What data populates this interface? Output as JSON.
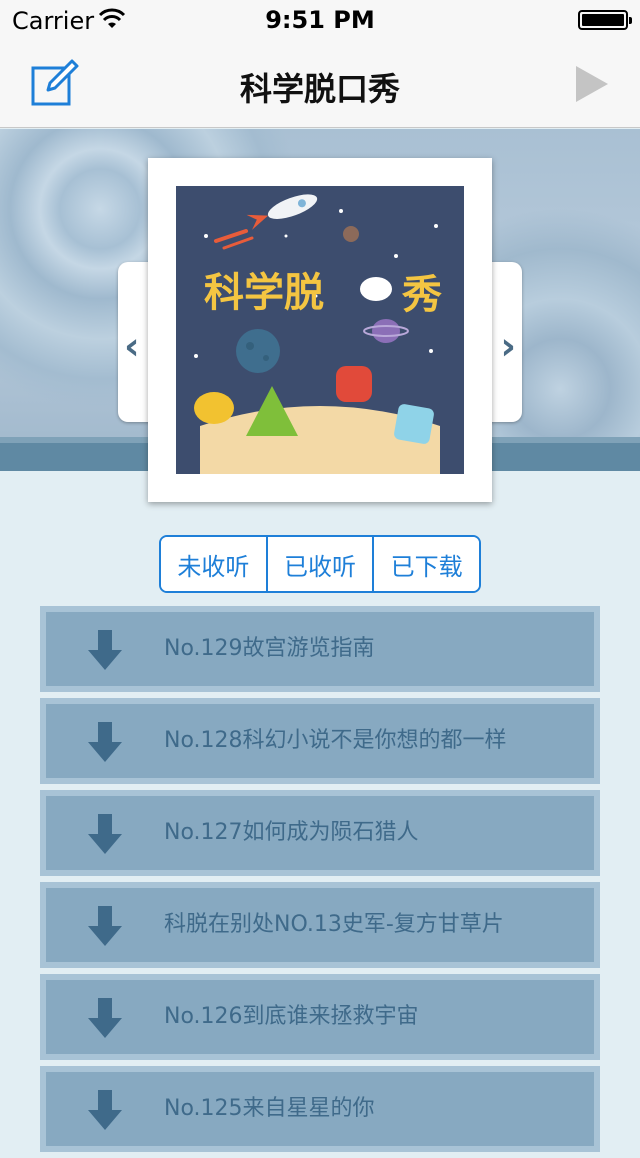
{
  "status": {
    "carrier": "Carrier",
    "time": "9:51 PM"
  },
  "nav": {
    "title": "科学脱口秀",
    "edit_icon": "edit-icon",
    "play_icon": "play-icon"
  },
  "cover": {
    "art_title": "科学脱口秀"
  },
  "segments": [
    "未收听",
    "已收听",
    "已下载"
  ],
  "episodes": [
    "No.129故宫游览指南",
    "No.128科幻小说不是你想的都一样",
    "No.127如何成为陨石猎人",
    "科脱在别处NO.13史军-复方甘草片",
    "No.126到底谁来拯救宇宙",
    "No.125来自星星的你"
  ],
  "colors": {
    "accent": "#1e7fd8",
    "list_bg": "#87a9c1",
    "list_text": "#3f6a8a"
  }
}
